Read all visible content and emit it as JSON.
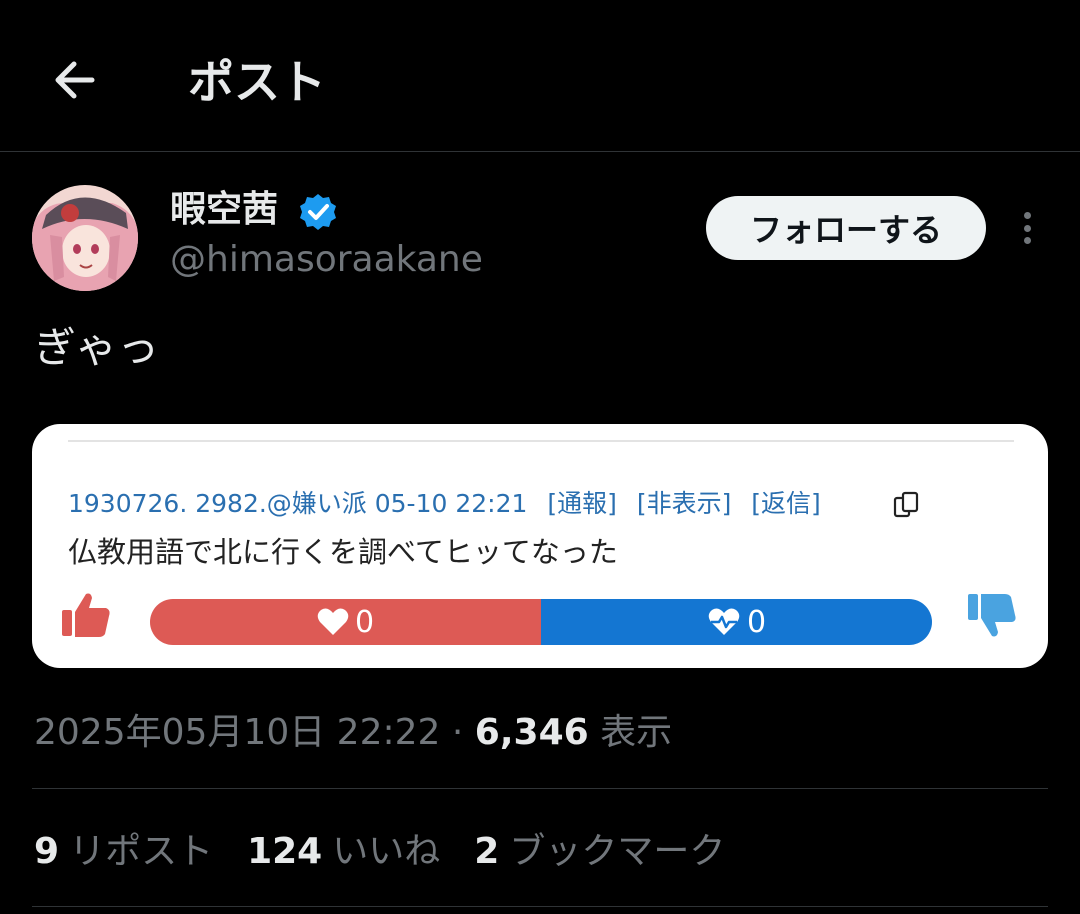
{
  "header": {
    "title": "ポスト"
  },
  "author": {
    "display_name": "暇空茜",
    "handle": "@himasoraakane",
    "verified": true
  },
  "follow_label": "フォローする",
  "post": {
    "text": "ぎゃっ"
  },
  "card": {
    "meta": {
      "id": "1930726. 2982.@嫌い派 05-10 22:21",
      "report": "[通報]",
      "hide": "[非表示]",
      "reply": "[返信]"
    },
    "body": "仏教用語で北に行くを調べてヒッてなった",
    "like_count": "0",
    "dislike_count": "0",
    "like_share": 0.5,
    "colors": {
      "like": "#dd5a55",
      "dislike": "#1476d2",
      "meta": "#2a6fb0"
    }
  },
  "timestamp": {
    "date": "2025年05月10日 22:22",
    "separator": "·",
    "views": "6,346",
    "views_label": "表示"
  },
  "stats": {
    "reposts_count": "9",
    "reposts_label": "リポスト",
    "likes_count": "124",
    "likes_label": "いいね",
    "bookmarks_count": "2",
    "bookmarks_label": "ブックマーク"
  },
  "icons": [
    "back-arrow-icon",
    "verified-badge-icon",
    "more-icon",
    "copy-icon",
    "thumbs-up-icon",
    "thumbs-down-icon",
    "heart-icon",
    "heart-pulse-icon"
  ]
}
